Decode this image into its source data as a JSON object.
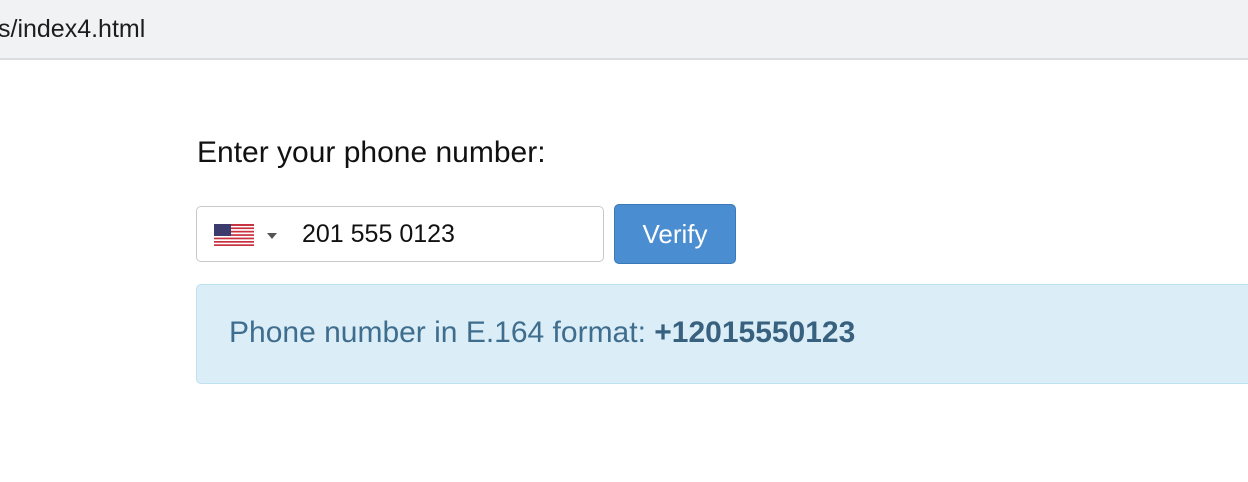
{
  "browser": {
    "url_fragment": "s/index4.html"
  },
  "form": {
    "label": "Enter your phone number:",
    "country_flag": "us-flag-icon",
    "phone_value": "201 555 0123",
    "verify_label": "Verify"
  },
  "result": {
    "prefix": "Phone number in E.164 format: ",
    "value": "+12015550123"
  },
  "colors": {
    "button": "#4a8dd0",
    "alert_bg": "#dbedf7",
    "alert_text": "#3f6d8e"
  }
}
